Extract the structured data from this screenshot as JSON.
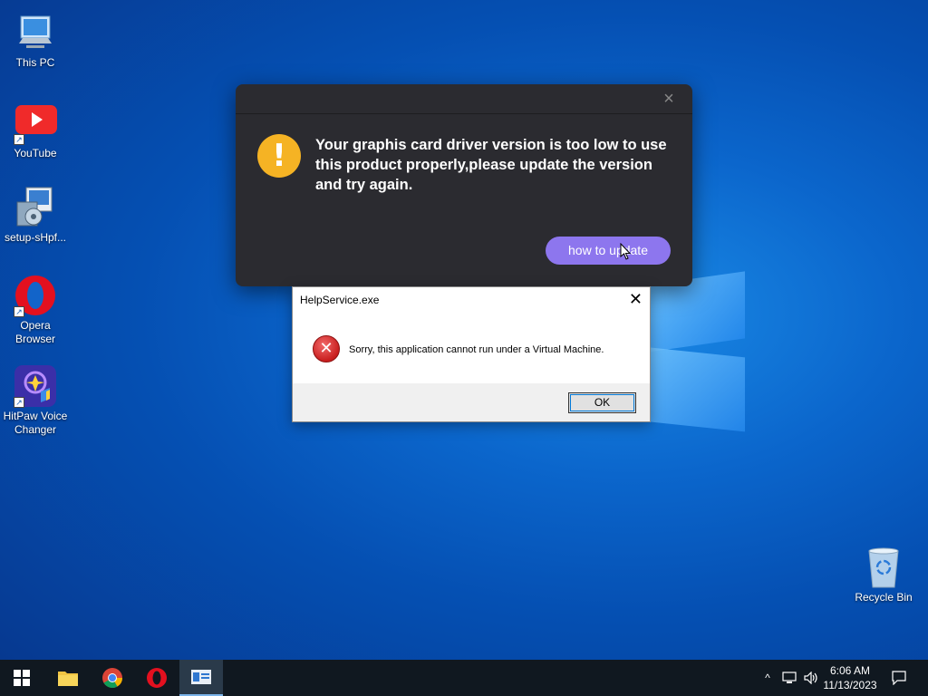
{
  "desktop": {
    "icons": [
      {
        "label": "This PC"
      },
      {
        "label": "YouTube"
      },
      {
        "label": "setup-sHpf..."
      },
      {
        "label": "Opera Browser"
      },
      {
        "label": "HitPaw Voice Changer"
      },
      {
        "label": "Recycle Bin"
      }
    ]
  },
  "update_dialog": {
    "message": "Your graphis card driver version is too low to use this product properly,please update the version and try again.",
    "button_label": "how to update",
    "close_glyph": "×",
    "icon_glyph": "!",
    "accent_color": "#8d76ee",
    "warning_color": "#f5b324"
  },
  "error_dialog": {
    "title": "HelpService.exe",
    "message": "Sorry, this application cannot run under a Virtual Machine.",
    "ok_label": "OK",
    "close_glyph": "✕",
    "icon_glyph": "✕"
  },
  "taskbar": {
    "items": [
      {
        "name": "start-button",
        "icon": "windows-logo-icon"
      },
      {
        "name": "file-explorer",
        "icon": "folder-icon"
      },
      {
        "name": "chrome",
        "icon": "chrome-icon"
      },
      {
        "name": "opera",
        "icon": "opera-icon"
      },
      {
        "name": "active-app",
        "icon": "window-app-icon"
      }
    ],
    "tray": {
      "chevron": "^",
      "network_icon": "network-icon",
      "volume_icon": "volume-icon",
      "notification_icon": "notification-icon"
    },
    "clock": {
      "time": "6:06 AM",
      "date": "11/13/2023"
    }
  }
}
